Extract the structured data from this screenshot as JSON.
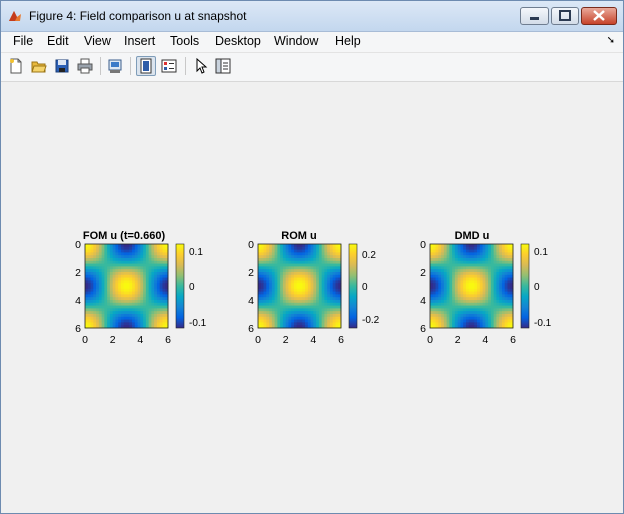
{
  "window": {
    "title": "Figure 4: Field comparison u at snapshot"
  },
  "menu": {
    "items": [
      "File",
      "Edit",
      "View",
      "Insert",
      "Tools",
      "Desktop",
      "Window",
      "Help"
    ]
  },
  "toolbar": {
    "icons": [
      "new-figure-icon",
      "open-file-icon",
      "save-icon",
      "print-icon",
      "print-preview-icon",
      "dock-figure-icon",
      "insert-legend-icon",
      "pointer-icon",
      "property-inspector-icon"
    ]
  },
  "plots": [
    {
      "title": "FOM u (t=0.660)",
      "colorbar_ticks": [
        "0.1",
        "0",
        "-0.1"
      ],
      "clim": [
        -0.13,
        0.13
      ]
    },
    {
      "title": "ROM u",
      "colorbar_ticks": [
        "0.2",
        "0",
        "-0.2"
      ],
      "clim": [
        -0.27,
        0.27
      ]
    },
    {
      "title": "DMD u",
      "colorbar_ticks": [
        "0.1",
        "0",
        "-0.1"
      ],
      "clim": [
        -0.13,
        0.13
      ]
    }
  ],
  "axes": {
    "xticks": [
      "0",
      "2",
      "4",
      "6"
    ],
    "yticks": [
      "0",
      "2",
      "4",
      "6"
    ]
  },
  "colors": {
    "parula": [
      "#352a87",
      "#0363e1",
      "#1485d4",
      "#06a7c6",
      "#38b99e",
      "#92bf73",
      "#d9ba56",
      "#fcce2e",
      "#f9fb0e"
    ]
  }
}
